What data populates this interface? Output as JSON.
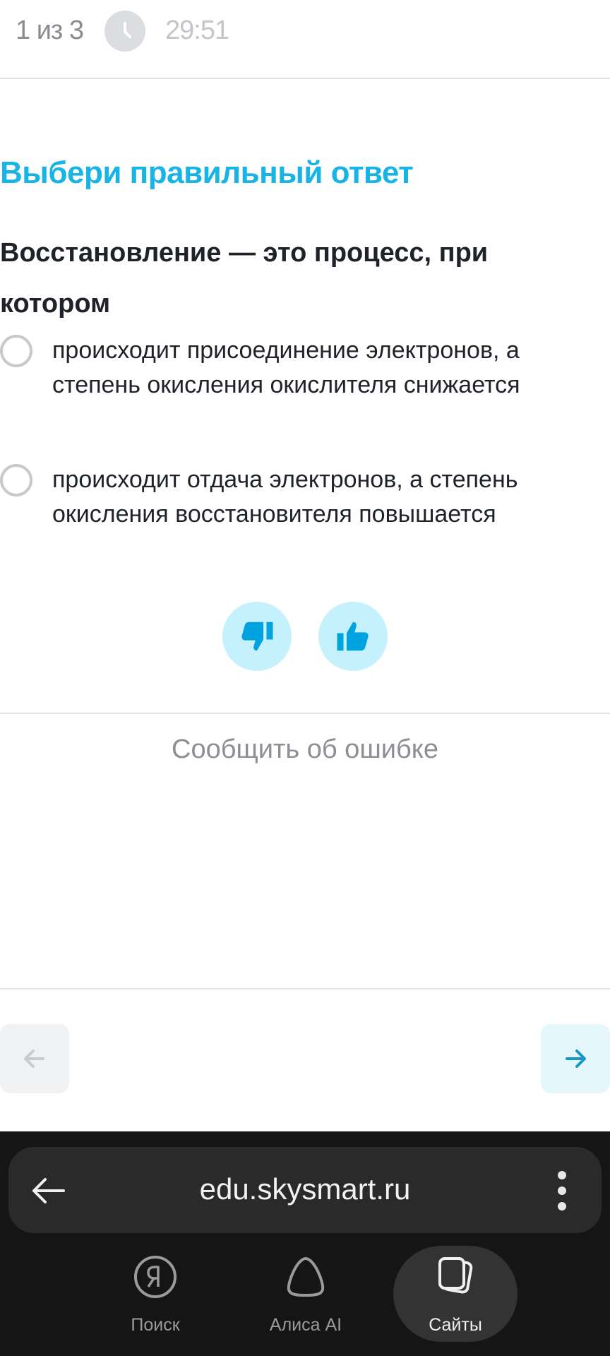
{
  "header": {
    "progress": "1 из 3",
    "timer": "29:51"
  },
  "question": {
    "instruction": "Выбери правильный ответ",
    "text": "Восстановление — это процесс, при котором",
    "options": [
      {
        "label": "происходит присоединение электронов, а степень окисления окислителя снижается",
        "selected": false
      },
      {
        "label": "происходит отдача электронов, а степень окисления восстановителя повышается",
        "selected": false
      }
    ]
  },
  "feedback": {
    "report_error_label": "Сообщить об ошибке"
  },
  "icons": {
    "clock": "clock-icon",
    "thumbs_down": "thumbs-down-icon",
    "thumbs_up": "thumbs-up-icon",
    "prev": "arrow-left-icon",
    "next": "arrow-right-icon",
    "browser_back": "arrow-left-icon",
    "menu": "more-vertical-icon",
    "search_tab": "yandex-logo-icon",
    "alice_tab": "alice-icon",
    "sites_tab": "tabs-icon"
  },
  "colors": {
    "accent": "#19b4e6",
    "thumb_bg": "#c4f1fc",
    "thumb_icon": "#00a3e0",
    "browser_bg": "#151515"
  },
  "browser": {
    "url": "edu.skysmart.ru",
    "tabs": [
      {
        "label": "Поиск"
      },
      {
        "label": "Алиса AI"
      },
      {
        "label": "Сайты"
      }
    ]
  }
}
